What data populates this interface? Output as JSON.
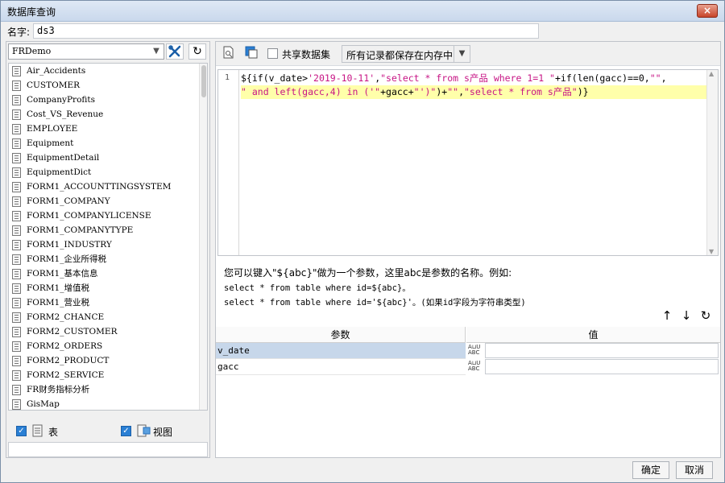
{
  "window": {
    "title": "数据库查询",
    "close_label": "×"
  },
  "name_field": {
    "label": "名字:",
    "value": "ds3"
  },
  "left": {
    "db_select": "FRDemo",
    "tables": [
      "Air_Accidents",
      "CUSTOMER",
      "CompanyProfits",
      "Cost_VS_Revenue",
      "EMPLOYEE",
      "Equipment",
      "EquipmentDetail",
      "EquipmentDict",
      "FORM1_ACCOUNTTINGSYSTEM",
      "FORM1_COMPANY",
      "FORM1_COMPANYLICENSE",
      "FORM1_COMPANYTYPE",
      "FORM1_INDUSTRY",
      "FORM1_企业所得税",
      "FORM1_基本信息",
      "FORM1_增值税",
      "FORM1_营业税",
      "FORM2_CHANCE",
      "FORM2_CUSTOMER",
      "FORM2_ORDERS",
      "FORM2_PRODUCT",
      "FORM2_SERVICE",
      "FR财务指标分析",
      "GisMap"
    ],
    "filter_table_label": "表",
    "filter_view_label": "视图"
  },
  "toolbar": {
    "share_label": "共享数据集",
    "memory_select": "所有记录都保存在内存中"
  },
  "editor": {
    "line_number": "1",
    "line1": [
      {
        "t": "${if(v_date>",
        "c": "black"
      },
      {
        "t": "'2019-10-11'",
        "c": "str"
      },
      {
        "t": ",",
        "c": "black"
      },
      {
        "t": "\"select * from s产品 where 1=1 \"",
        "c": "str"
      },
      {
        "t": "+if(len(gacc)==0,",
        "c": "black"
      },
      {
        "t": "\"\"",
        "c": "str"
      },
      {
        "t": ",",
        "c": "black"
      }
    ],
    "line2": [
      {
        "t": "\" and left(gacc,4) in ('\"",
        "c": "str"
      },
      {
        "t": "+gacc+",
        "c": "black"
      },
      {
        "t": "\"')\"",
        "c": "str"
      },
      {
        "t": ")+",
        "c": "black"
      },
      {
        "t": "\"\"",
        "c": "str"
      },
      {
        "t": ",",
        "c": "black"
      },
      {
        "t": "\"select * from s产品\"",
        "c": "str"
      },
      {
        "t": ")}",
        "c": "black"
      }
    ]
  },
  "hint": {
    "line1": "您可以键入\"${abc}\"做为一个参数，这里abc是参数的名称。例如:",
    "line2": "select * from table where id=${abc}。",
    "line3": "select * from table where id='${abc}'。(如果id字段为字符串类型)"
  },
  "params": {
    "header_name": "参数",
    "header_value": "值",
    "rows": [
      {
        "name": "v_date",
        "type": "A⊔U ABC",
        "value": ""
      },
      {
        "name": "gacc",
        "type": "A⊔U ABC",
        "value": ""
      }
    ]
  },
  "footer": {
    "ok_label": "确定",
    "cancel_label": "取消"
  }
}
